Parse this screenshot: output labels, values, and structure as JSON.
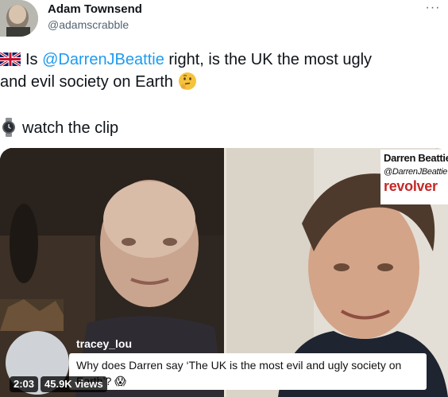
{
  "author": {
    "display_name": "Adam Townsend",
    "handle": "@adamscrabble",
    "avatar_icon": "profile-photo"
  },
  "more_menu": {
    "label": "···",
    "icon": "more-icon"
  },
  "tweet": {
    "flag_icon": "uk-flag-emoji",
    "text_part1": "Is ",
    "mention": "@DarrenJBeattie",
    "text_part2": " right, is the UK the most ugly",
    "text_line2": "and evil society on Earth",
    "thinking_icon": "thinking-face-emoji",
    "watch_icon": "watch-emoji",
    "text_line3": "watch the clip",
    "mention_color": "#1d9bf0"
  },
  "video": {
    "overlay_brand": {
      "name": "Darren Beattie",
      "handle": "@DarrenJBeattie",
      "logo": "revolver",
      "logo_color": "#c62828"
    },
    "comment": {
      "user": "tracey_lou",
      "text": "Why does Darren say ‘The UK is the most evil and ugly society on Earth’? 😱"
    },
    "duration": "2:03",
    "views": "45.9K views"
  }
}
